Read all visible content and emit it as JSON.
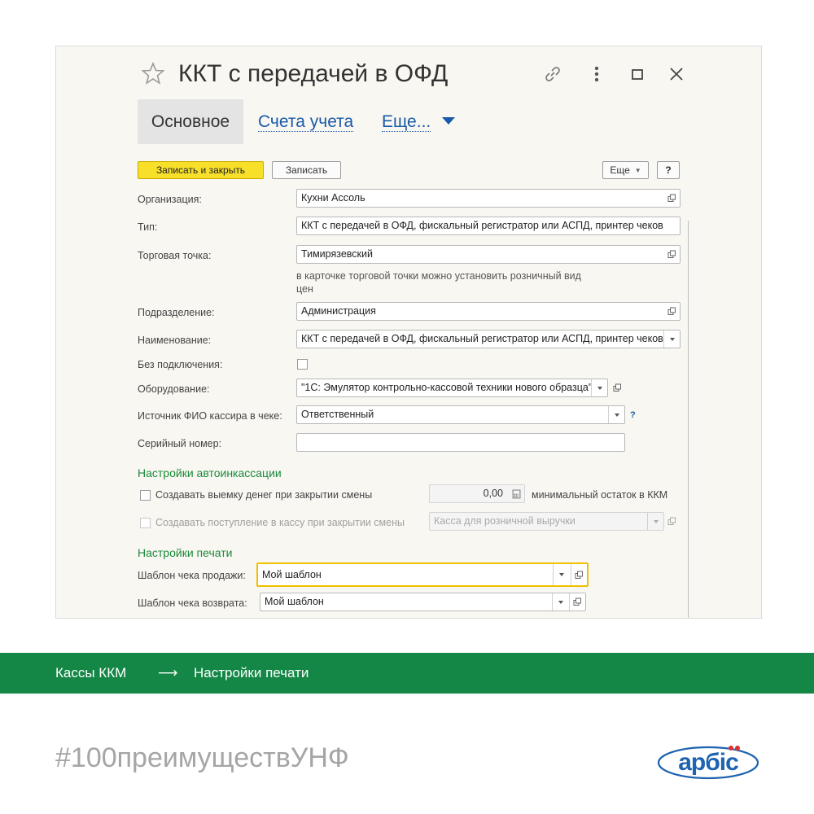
{
  "window": {
    "title": "ККТ с передачей в ОФД",
    "tabs": [
      {
        "label": "Основное"
      },
      {
        "label": "Счета учета"
      },
      {
        "label": "Еще..."
      }
    ],
    "toolbar": {
      "save_close_label": "Записать и закрыть",
      "save_label": "Записать",
      "more_label": "Еще",
      "help_label": "?"
    },
    "form": {
      "organization": {
        "label": "Организация:",
        "value": "Кухни Ассоль"
      },
      "type": {
        "label": "Тип:",
        "value": "ККТ с передачей в ОФД, фискальный регистратор или АСПД, принтер чеков"
      },
      "trade_point": {
        "label": "Торговая точка:",
        "value": "Тимирязевский"
      },
      "trade_point_hint_1": "в карточке торговой точки можно установить розничный вид",
      "trade_point_hint_2": "цен",
      "department": {
        "label": "Подразделение:",
        "value": "Администрация"
      },
      "name": {
        "label": "Наименование:",
        "value": "ККТ с передачей в ОФД, фискальный регистратор или АСПД, принтер чеков"
      },
      "no_connection": {
        "label": "Без подключения:"
      },
      "equipment": {
        "label": "Оборудование:",
        "value": "\"1С: Эмулятор контрольно-кассовой техники нового образца\""
      },
      "cashier_source": {
        "label": "Источник ФИО кассира в чеке:",
        "value": "Ответственный",
        "help": "?"
      },
      "serial_number": {
        "label": "Серийный номер:",
        "value": ""
      }
    },
    "autocollection": {
      "section_title": "Настройки автоинкассации",
      "withdraw_label": "Создавать выемку денег при закрытии смены",
      "withdraw_amount": "0,00",
      "withdraw_suffix": "минимальный остаток в ККМ",
      "receipt_label": "Создавать поступление в кассу при закрытии смены",
      "receipt_cashbox": "Касса для розничной выручки"
    },
    "print": {
      "section_title": "Настройки печати",
      "sale_template": {
        "label": "Шаблон чека продажи:",
        "value": "Мой шаблон"
      },
      "return_template": {
        "label": "Шаблон чека возврата:",
        "value": "Мой шаблон"
      }
    }
  },
  "breadcrumb": {
    "item1": "Кассы ККМ",
    "arrow": "⟶",
    "item2": "Настройки печати"
  },
  "hashtag": "#100преимуществУНФ",
  "logo_text": "арбіс",
  "colors": {
    "accent_green": "#148746",
    "link_blue": "#1a5aa8",
    "primary_yellow": "#f7df2a",
    "section_green": "#1a8a3a",
    "logo_blue": "#1e63b0",
    "logo_red": "#e0302c"
  }
}
